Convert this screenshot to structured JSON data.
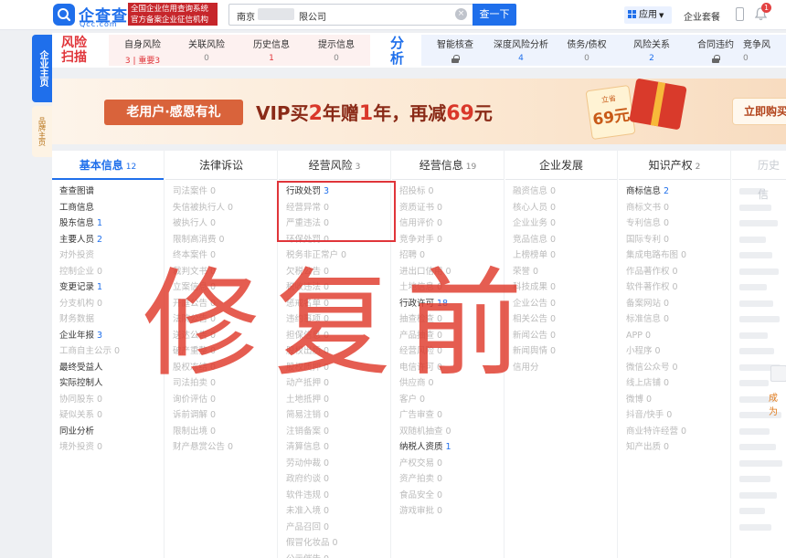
{
  "header": {
    "logo_name": "企查查",
    "logo_domain": "Qcc.com",
    "logo_slogan_1": "全国企业信用查询系统",
    "logo_slogan_2": "官方备案企业征信机构",
    "search_prefix": "南京",
    "search_suffix": "限公司",
    "search_button": "查一下",
    "apps_label": "应用",
    "package_label": "企业套餐",
    "notif_count": "1"
  },
  "side_tabs": [
    "企业主页",
    "品牌主页"
  ],
  "risk": {
    "title": "风险扫描",
    "items": [
      {
        "label": "自身风险",
        "value": "3 | 重要3",
        "highlight": true
      },
      {
        "label": "关联风险",
        "value": "0"
      },
      {
        "label": "历史信息",
        "value": "1",
        "red": true
      },
      {
        "label": "提示信息",
        "value": "0"
      }
    ]
  },
  "analysis": {
    "title": "分析",
    "items": [
      {
        "label": "智能核查",
        "value": "",
        "locked": true
      },
      {
        "label": "深度风险分析",
        "value": "4"
      },
      {
        "label": "债务/债权",
        "value": "0"
      },
      {
        "label": "风险关系",
        "value": "2"
      },
      {
        "label": "合同违约",
        "value": "",
        "locked": true
      },
      {
        "label": "竞争风",
        "value": "0"
      }
    ]
  },
  "banner": {
    "tag": "老用户·感恩有礼",
    "text_1": "VIP买",
    "num_1": "2",
    "text_2": "年赠",
    "num_2": "1",
    "text_3": "年，再减",
    "num_3": "69",
    "text_4": "元",
    "coupon_save": "立省",
    "coupon_amount": "69元",
    "cta": "立即购买"
  },
  "columns": [
    {
      "title": "基本信息",
      "count": "12",
      "active": true,
      "items": [
        {
          "l": "查查图谱",
          "on": true
        },
        {
          "l": "工商信息",
          "on": true
        },
        {
          "l": "股东信息",
          "n": "1",
          "on": true
        },
        {
          "l": "主要人员",
          "n": "2",
          "on": true
        },
        {
          "l": "对外投资"
        },
        {
          "l": "控制企业",
          "n": "0"
        },
        {
          "l": "变更记录",
          "n": "1",
          "on": true
        },
        {
          "l": "分支机构",
          "n": "0"
        },
        {
          "l": "财务数据"
        },
        {
          "l": "企业年报",
          "n": "3",
          "on": true
        },
        {
          "l": "工商自主公示",
          "n": "0"
        },
        {
          "l": "最终受益人",
          "on": true
        },
        {
          "l": "实际控制人",
          "on": true
        },
        {
          "l": "协同股东",
          "n": "0"
        },
        {
          "l": "疑似关系",
          "n": "0"
        },
        {
          "l": "同业分析",
          "on": true
        },
        {
          "l": "境外投资",
          "n": "0"
        }
      ]
    },
    {
      "title": "法律诉讼",
      "count": "",
      "items": [
        {
          "l": "司法案件",
          "n": "0"
        },
        {
          "l": "失信被执行人",
          "n": "0"
        },
        {
          "l": "被执行人",
          "n": "0"
        },
        {
          "l": "限制高消费",
          "n": "0"
        },
        {
          "l": "终本案件",
          "n": "0"
        },
        {
          "l": "裁判文书",
          "n": "0"
        },
        {
          "l": "立案信息",
          "n": "0"
        },
        {
          "l": "开庭公告",
          "n": "0"
        },
        {
          "l": "法院公告",
          "n": "0"
        },
        {
          "l": "送达公告",
          "n": "0"
        },
        {
          "l": "破产重整",
          "n": "0"
        },
        {
          "l": "股权冻结",
          "n": "0"
        },
        {
          "l": "司法拍卖",
          "n": "0"
        },
        {
          "l": "询价评估",
          "n": "0"
        },
        {
          "l": "诉前调解",
          "n": "0"
        },
        {
          "l": "限制出境",
          "n": "0"
        },
        {
          "l": "财产悬赏公告",
          "n": "0"
        }
      ]
    },
    {
      "title": "经营风险",
      "count": "3",
      "items": [
        {
          "l": "行政处罚",
          "n": "3",
          "on": true
        },
        {
          "l": "经营异常",
          "n": "0"
        },
        {
          "l": "严重违法",
          "n": "0"
        },
        {
          "l": "环保处罚",
          "n": "0"
        },
        {
          "l": "税务非正常户",
          "n": "0"
        },
        {
          "l": "欠税公告",
          "n": "0"
        },
        {
          "l": "税收违法",
          "n": "0"
        },
        {
          "l": "惩戒名单",
          "n": "0"
        },
        {
          "l": "违约事项",
          "n": "0"
        },
        {
          "l": "担保信息",
          "n": "0"
        },
        {
          "l": "股权出质",
          "n": "0"
        },
        {
          "l": "股权质押",
          "n": "0"
        },
        {
          "l": "动产抵押",
          "n": "0"
        },
        {
          "l": "土地抵押",
          "n": "0"
        },
        {
          "l": "简易注销",
          "n": "0"
        },
        {
          "l": "注销备案",
          "n": "0"
        },
        {
          "l": "清算信息",
          "n": "0"
        },
        {
          "l": "劳动仲裁",
          "n": "0"
        },
        {
          "l": "政府约谈",
          "n": "0"
        },
        {
          "l": "软件违规",
          "n": "0"
        },
        {
          "l": "未准入境",
          "n": "0"
        },
        {
          "l": "产品召回",
          "n": "0"
        },
        {
          "l": "假冒化妆品",
          "n": "0"
        },
        {
          "l": "公示催告",
          "n": "0"
        }
      ]
    },
    {
      "title": "经营信息",
      "count": "19",
      "items": [
        {
          "l": "招投标",
          "n": "0"
        },
        {
          "l": "资质证书",
          "n": "0"
        },
        {
          "l": "信用评价",
          "n": "0"
        },
        {
          "l": "竞争对手",
          "n": "0"
        },
        {
          "l": "招聘",
          "n": "0"
        },
        {
          "l": "进出口信用",
          "n": "0"
        },
        {
          "l": "土地信息",
          "n": "0"
        },
        {
          "l": "行政许可",
          "n": "18",
          "on": true
        },
        {
          "l": "抽查检查",
          "n": "0"
        },
        {
          "l": "产品抽查",
          "n": "0"
        },
        {
          "l": "经营风险",
          "n": "0"
        },
        {
          "l": "电信许可",
          "n": "0"
        },
        {
          "l": "供应商",
          "n": "0"
        },
        {
          "l": "客户",
          "n": "0"
        },
        {
          "l": "广告审查",
          "n": "0"
        },
        {
          "l": "双随机抽查",
          "n": "0"
        },
        {
          "l": "纳税人资质",
          "n": "1",
          "on": true
        },
        {
          "l": "产权交易",
          "n": "0"
        },
        {
          "l": "资产拍卖",
          "n": "0"
        },
        {
          "l": "食品安全",
          "n": "0"
        },
        {
          "l": "游戏审批",
          "n": "0"
        }
      ]
    },
    {
      "title": "企业发展",
      "count": "",
      "items": [
        {
          "l": "融资信息",
          "n": "0"
        },
        {
          "l": "核心人员",
          "n": "0"
        },
        {
          "l": "企业业务",
          "n": "0"
        },
        {
          "l": "竞品信息",
          "n": "0"
        },
        {
          "l": "上榜榜单",
          "n": "0"
        },
        {
          "l": "荣誉",
          "n": "0"
        },
        {
          "l": "科技成果",
          "n": "0"
        },
        {
          "l": "企业公告",
          "n": "0"
        },
        {
          "l": "相关公告",
          "n": "0"
        },
        {
          "l": "新闻公告",
          "n": "0"
        },
        {
          "l": "新闻舆情",
          "n": "0"
        },
        {
          "l": "信用分"
        }
      ]
    },
    {
      "title": "知识产权",
      "count": "2",
      "items": [
        {
          "l": "商标信息",
          "n": "2",
          "on": true
        },
        {
          "l": "商标文书",
          "n": "0"
        },
        {
          "l": "专利信息",
          "n": "0"
        },
        {
          "l": "国际专利",
          "n": "0"
        },
        {
          "l": "集成电路布图",
          "n": "0"
        },
        {
          "l": "作品著作权",
          "n": "0"
        },
        {
          "l": "软件著作权",
          "n": "0"
        },
        {
          "l": "备案网站",
          "n": "0"
        },
        {
          "l": "标准信息",
          "n": "0"
        },
        {
          "l": "APP",
          "n": "0"
        },
        {
          "l": "小程序",
          "n": "0"
        },
        {
          "l": "微信公众号",
          "n": "0"
        },
        {
          "l": "线上店铺",
          "n": "0"
        },
        {
          "l": "微博",
          "n": "0"
        },
        {
          "l": "抖音/快手",
          "n": "0"
        },
        {
          "l": "商业特许经营",
          "n": "0"
        },
        {
          "l": "知产出质",
          "n": "0"
        }
      ]
    },
    {
      "title": "历史信",
      "count": "",
      "blurred": true,
      "items": []
    }
  ],
  "last_col_extra": "成为",
  "watermark": "修复前",
  "colors": {
    "brand": "#1f6feb",
    "risk_red": "#e0353a",
    "watermark": "#e03a2c"
  }
}
